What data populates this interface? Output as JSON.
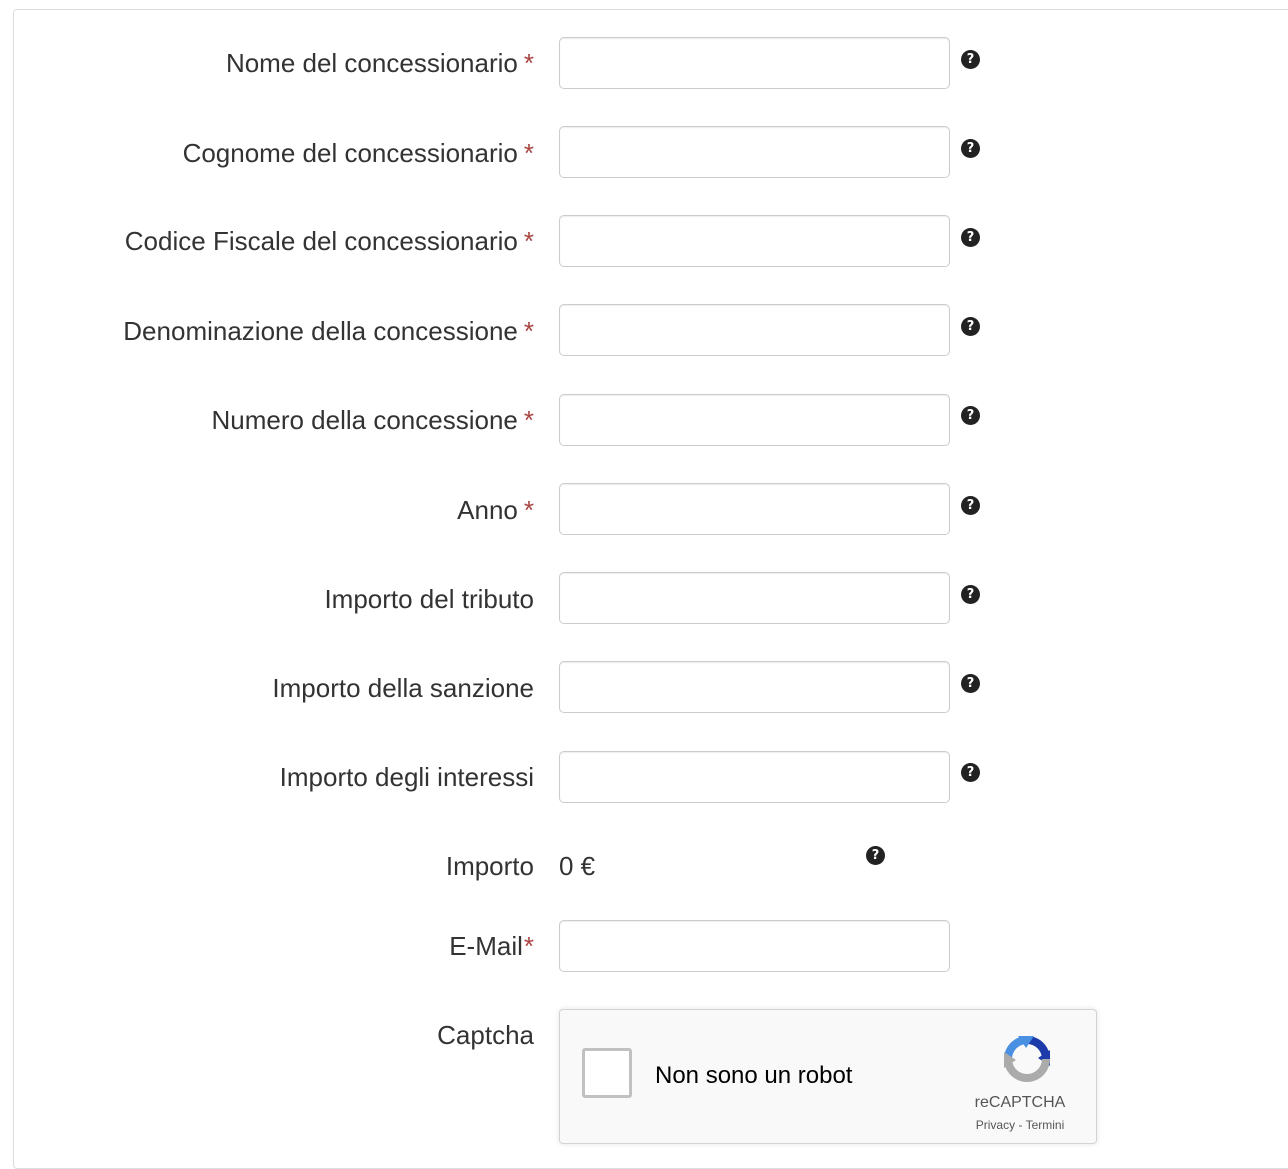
{
  "form": {
    "fields": [
      {
        "label": "Nome del concessionario",
        "required_mark": "*",
        "value": ""
      },
      {
        "label": "Cognome del concessionario",
        "required_mark": "*",
        "value": ""
      },
      {
        "label": "Codice Fiscale del concessionario",
        "required_mark": "*",
        "value": ""
      },
      {
        "label": "Denominazione della concessione",
        "required_mark": "*",
        "value": ""
      },
      {
        "label": "Numero della concessione",
        "required_mark": "*",
        "value": ""
      },
      {
        "label": "Anno",
        "required_mark": "*",
        "value": ""
      },
      {
        "label": "Importo del tributo",
        "value": ""
      },
      {
        "label": "Importo della sanzione",
        "value": ""
      },
      {
        "label": "Importo degli interessi",
        "value": ""
      }
    ],
    "importo": {
      "label": "Importo",
      "value": "0 €"
    },
    "email": {
      "label": "E-Mail",
      "required_mark": "*",
      "value": ""
    },
    "captcha": {
      "label": "Captcha",
      "checkbox_label": "Non sono un robot",
      "brand": "reCAPTCHA",
      "privacy_link": "Privacy",
      "separator": " - ",
      "terms_link": "Termini"
    },
    "help_glyph": "?"
  },
  "colors": {
    "required": "#a94442",
    "text": "#333333",
    "input_border": "#cccccc",
    "help_icon": "#222222"
  }
}
